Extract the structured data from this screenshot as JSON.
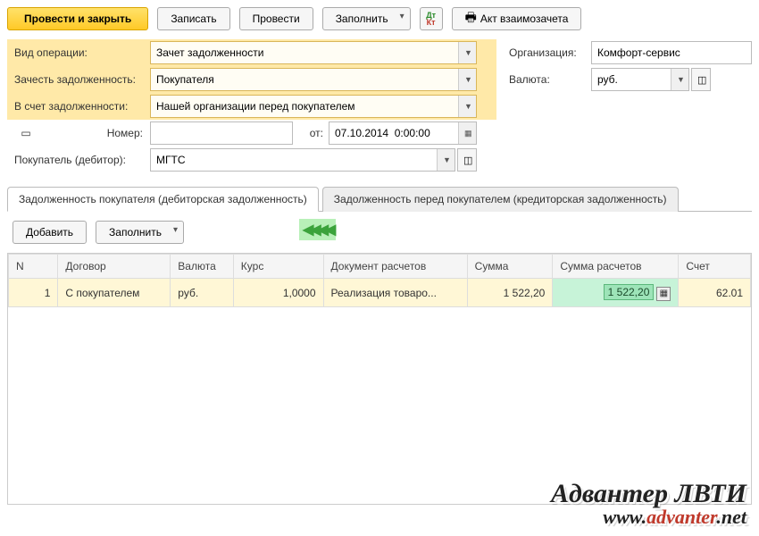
{
  "toolbar": {
    "submit_close": "Провести и закрыть",
    "save": "Записать",
    "submit": "Провести",
    "fill": "Заполнить",
    "act": "Акт взаимозачета"
  },
  "fields": {
    "operation_label": "Вид операции:",
    "operation_value": "Зачет задолженности",
    "offset_label": "Зачесть задолженность:",
    "offset_value": "Покупателя",
    "against_label": "В счет задолженности:",
    "against_value": "Нашей организации перед покупателем",
    "number_label": "Номер:",
    "number_value": "",
    "from_label": "от:",
    "date_value": "07.10.2014  0:00:00",
    "buyer_label": "Покупатель (дебитор):",
    "buyer_value": "МГТС",
    "org_label": "Организация:",
    "org_value": "Комфорт-сервис",
    "currency_label": "Валюта:",
    "currency_value": "руб."
  },
  "tabs": {
    "debit": "Задолженность покупателя (дебиторская задолженность)",
    "credit": "Задолженность перед покупателем (кредиторская задолженность)"
  },
  "subtoolbar": {
    "add": "Добавить",
    "fill": "Заполнить"
  },
  "table": {
    "headers": {
      "n": "N",
      "contract": "Договор",
      "currency": "Валюта",
      "rate": "Курс",
      "doc": "Документ расчетов",
      "sum": "Сумма",
      "calc_sum": "Сумма расчетов",
      "account": "Счет"
    },
    "rows": [
      {
        "n": "1",
        "contract": "С покупателем",
        "currency": "руб.",
        "rate": "1,0000",
        "doc": "Реализация товаро...",
        "sum": "1 522,20",
        "calc_sum": "1 522,20",
        "account": "62.01"
      }
    ]
  },
  "watermark": {
    "title": "Адвантер ЛВТИ",
    "url_pre": "www.",
    "url_mid": "advanter",
    "url_post": ".net"
  }
}
